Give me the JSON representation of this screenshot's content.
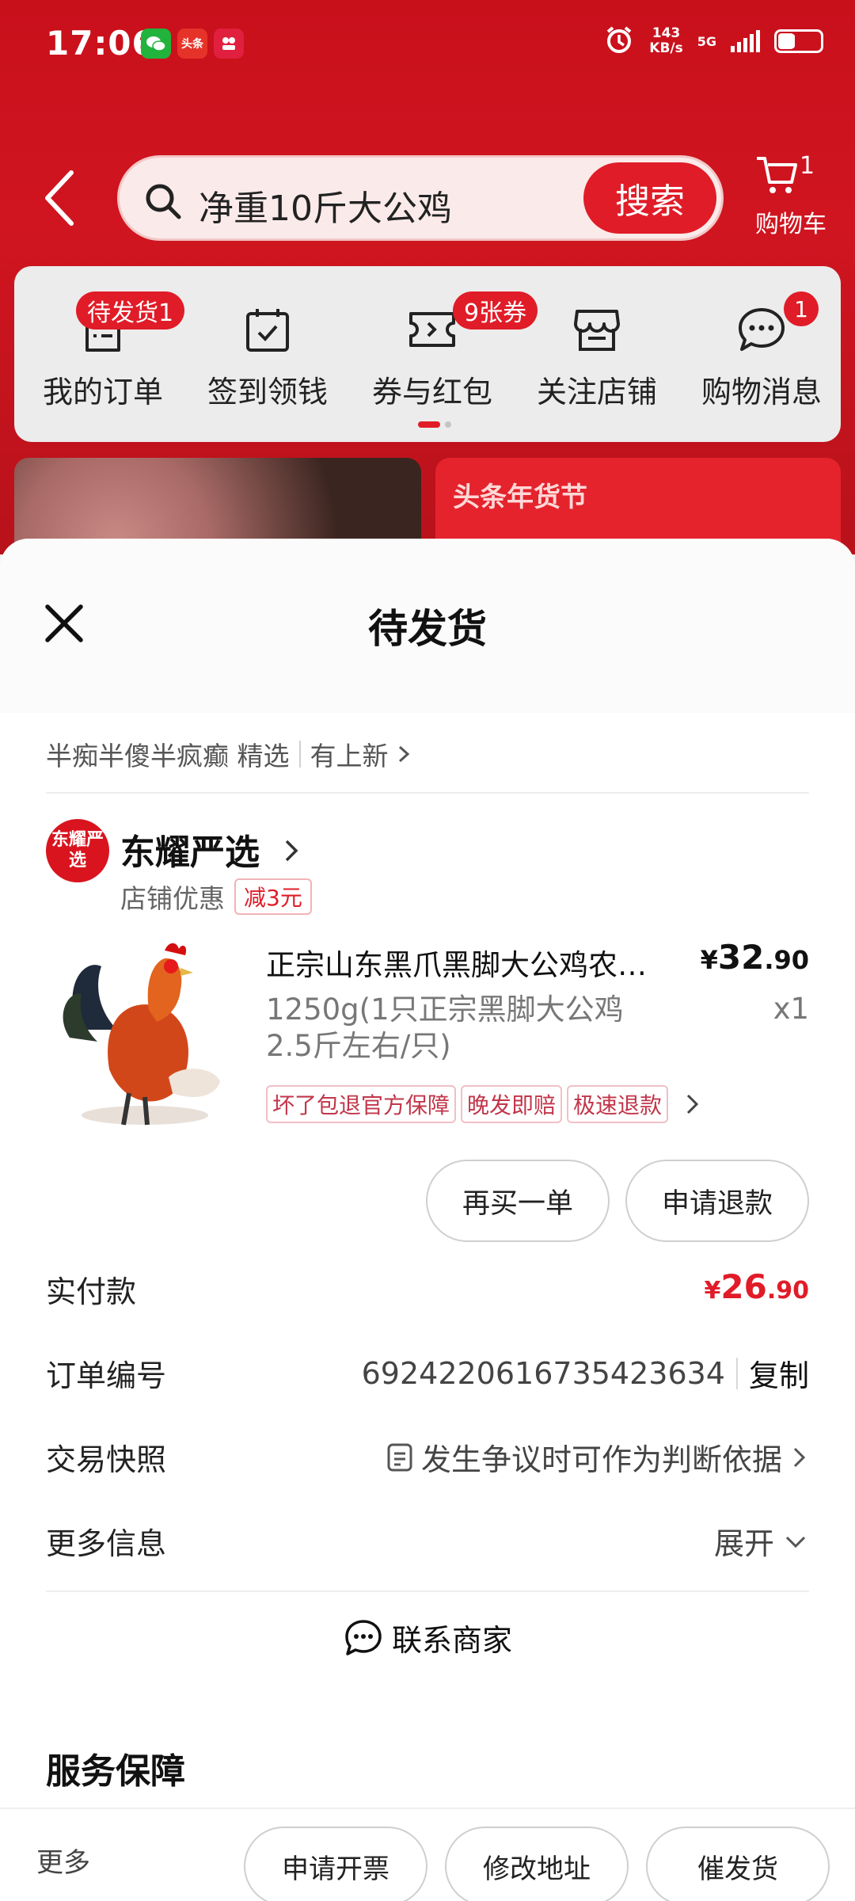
{
  "status_bar": {
    "time": "17:06",
    "apps": [
      "wechat-icon",
      "toutiao-icon",
      "app-icon"
    ],
    "toutiao_text": "头条",
    "net_speed_value": "143",
    "net_speed_unit": "KB/s",
    "net_type": "5G",
    "battery_level": 0.35
  },
  "header": {
    "search_text": "净重10斤大公鸡",
    "search_button": "搜索",
    "cart_count": "1",
    "cart_label": "购物车"
  },
  "shortcuts": [
    {
      "label": "我的订单",
      "badge": "待发货1",
      "icon": "order-list-icon"
    },
    {
      "label": "签到领钱",
      "badge": "",
      "icon": "calendar-check-icon"
    },
    {
      "label": "券与红包",
      "badge": "9张券",
      "icon": "coupon-icon"
    },
    {
      "label": "关注店铺",
      "badge": "",
      "icon": "store-icon"
    },
    {
      "label": "购物消息",
      "badge": "1",
      "icon": "chat-bubble-icon"
    }
  ],
  "banner": {
    "right_title": "头条年货节"
  },
  "sheet": {
    "title": "待发货",
    "shop_tip_main": "半痴半傻半疯癫 精选",
    "shop_tip_link": "有上新",
    "store": {
      "logo_text": "东耀严选",
      "name": "东耀严选",
      "promo_label": "店铺优惠",
      "promo_badge": "减3元"
    },
    "product": {
      "title": "正宗山东黑爪黑脚大公鸡农…",
      "price_currency": "¥",
      "price_int": "32",
      "price_dec": ".90",
      "spec": "1250g(1只正宗黑脚大公鸡2.5斤左右/只)",
      "quantity": "x1",
      "tags": [
        "坏了包退官方保障",
        "晚发即赔",
        "极速退款"
      ]
    },
    "actions": {
      "rebuy": "再买一单",
      "refund": "申请退款"
    },
    "info": {
      "paid_label": "实付款",
      "paid_currency": "¥",
      "paid_int": "26",
      "paid_dec": ".90",
      "order_no_label": "订单编号",
      "order_no": "6924220616735423634",
      "copy": "复制",
      "snapshot_label": "交易快照",
      "snapshot_value": "发生争议时可作为判断依据",
      "more_label": "更多信息",
      "more_value": "展开"
    },
    "contact": "联系商家",
    "service_title": "服务保障"
  },
  "bottom_bar": {
    "more": "更多",
    "buttons": [
      "申请开票",
      "修改地址",
      "催发货"
    ]
  },
  "colors": {
    "brand_red": "#e01c28",
    "header_bg": "#c8101b"
  }
}
